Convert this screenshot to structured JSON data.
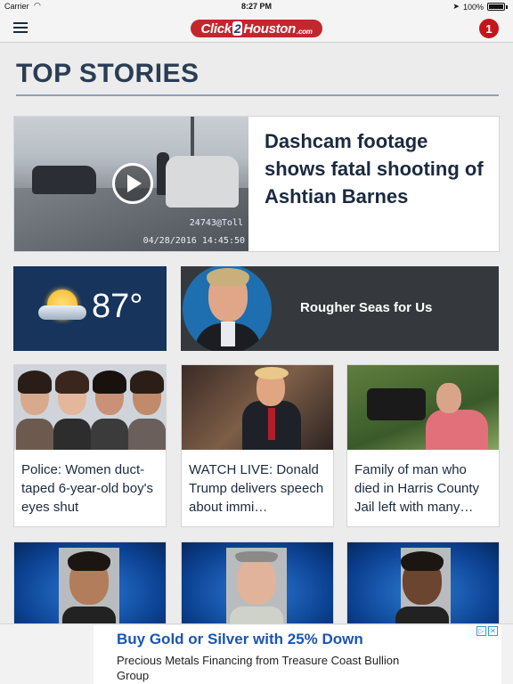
{
  "status_bar": {
    "carrier": "Carrier",
    "time": "8:27 PM",
    "battery": "100%"
  },
  "navbar": {
    "logo_left": "Click",
    "logo_two": "2",
    "logo_right": "Houston",
    "logo_com": ".com",
    "notification_count": "1"
  },
  "section": {
    "title": "TOP STORIES"
  },
  "hero": {
    "title": "Dashcam footage shows fatal shooting of Ashtian Barnes",
    "stamp_top": "24743@Toll",
    "stamp_bottom": "04/28/2016 14:45:50"
  },
  "weather": {
    "temperature": "87°"
  },
  "promo": {
    "title": "Rougher Seas for Us"
  },
  "cards": [
    {
      "text": "Police: Women duct-taped 6-year-old boy's eyes shut"
    },
    {
      "text": "WATCH LIVE: Donald Trump delivers speech about immi…"
    },
    {
      "text": "Family of man who died in Harris County Jail left with many…"
    }
  ],
  "ad": {
    "headline": "Buy Gold or Silver with 25% Down",
    "body": "Precious Metals Financing from Treasure Coast Bullion Group",
    "choices_icon": "adchoices-icon",
    "close_icon": "close-icon"
  },
  "colors": {
    "brand_red": "#c4262e",
    "navy": "#16345c",
    "heading": "#2a3d55",
    "ad_link": "#1a55b5"
  }
}
